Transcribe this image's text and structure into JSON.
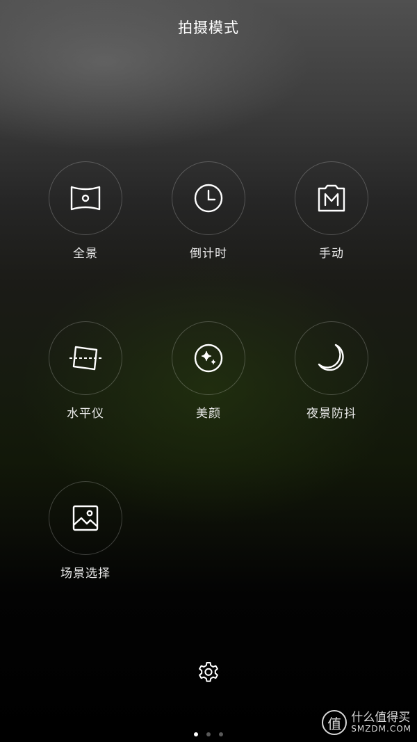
{
  "header": {
    "title": "拍摄模式"
  },
  "modes": [
    {
      "label": "全景",
      "icon": "panorama-icon"
    },
    {
      "label": "倒计时",
      "icon": "clock-icon"
    },
    {
      "label": "手动",
      "icon": "manual-m-icon"
    },
    {
      "label": "水平仪",
      "icon": "level-icon"
    },
    {
      "label": "美颜",
      "icon": "sparkle-icon"
    },
    {
      "label": "夜景防抖",
      "icon": "moon-icon"
    },
    {
      "label": "场景选择",
      "icon": "image-icon"
    }
  ],
  "settings": {
    "icon": "gear-icon"
  },
  "pager": {
    "pages": 3,
    "active_page": 1
  },
  "watermark": {
    "logo_char": "值",
    "text_cn": "什么值得买",
    "text_en": "SMZDM.COM"
  }
}
